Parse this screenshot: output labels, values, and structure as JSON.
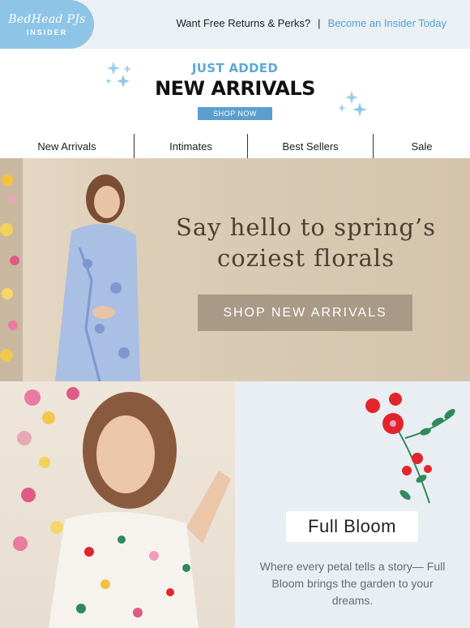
{
  "header": {
    "logo_script": "BedHead PJs",
    "logo_sub": "INSIDER",
    "promo_text": "Want Free Returns & Perks?",
    "separator": "|",
    "promo_link": "Become an Insider Today"
  },
  "just_added": {
    "kicker": "JUST ADDED",
    "title": "NEW ARRIVALS",
    "button": "SHOP NOW"
  },
  "nav": {
    "items": [
      {
        "label": "New Arrivals"
      },
      {
        "label": "Intimates"
      },
      {
        "label": "Best Sellers"
      },
      {
        "label": "Sale"
      }
    ]
  },
  "banner": {
    "headline_line1": "Say hello to spring’s",
    "headline_line2": "coziest florals",
    "button": "SHOP NEW ARRIVALS"
  },
  "full_bloom": {
    "title": "Full Bloom",
    "body": "Where every petal tells a story— Full Bloom brings the garden to your dreams."
  },
  "colors": {
    "topbar_bg": "#eaf0f4",
    "logo_bg": "#8ec5e6",
    "accent_blue": "#4ba3d3",
    "button_taupe": "#a89a86",
    "flower_red": "#e2242d",
    "leaf_green": "#2f8a5b"
  },
  "icons": [
    "sparkle-icon",
    "flower-illustration"
  ]
}
